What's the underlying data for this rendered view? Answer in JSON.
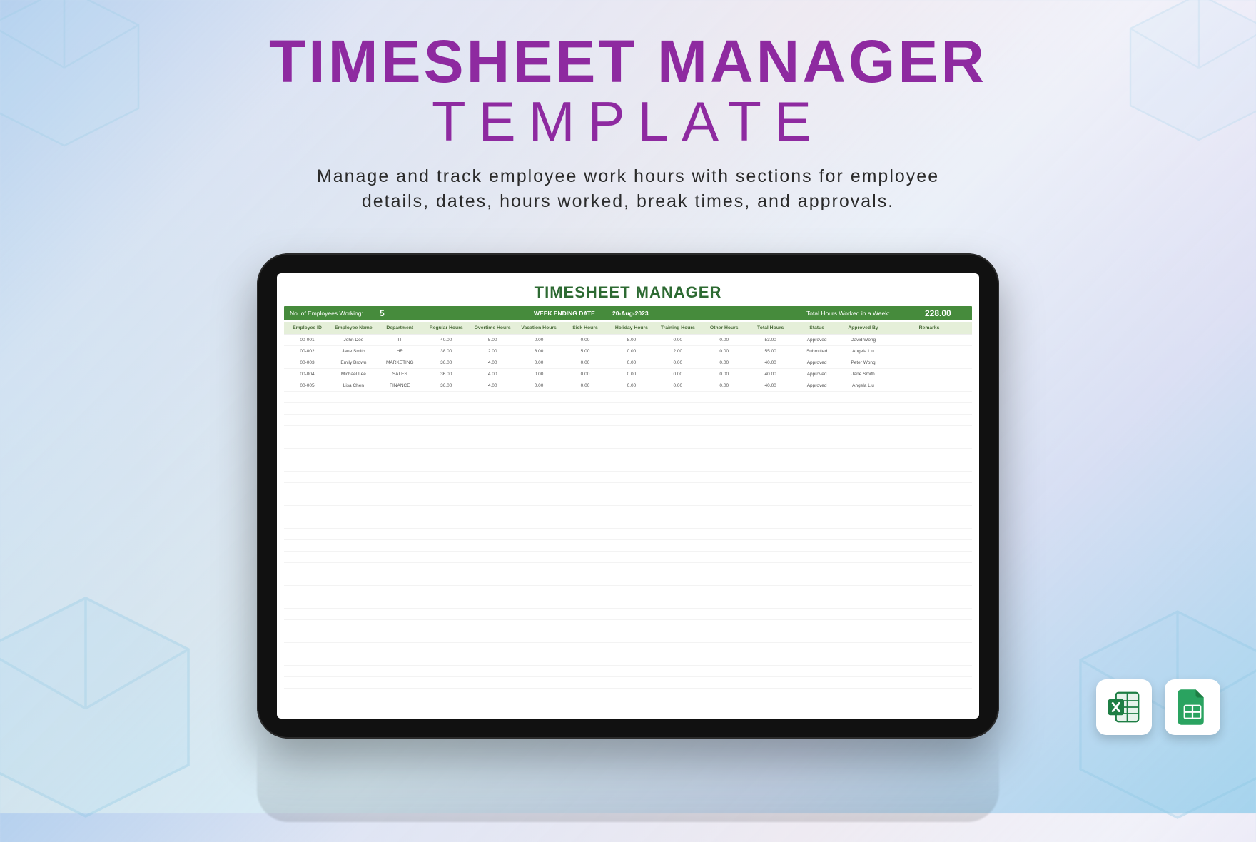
{
  "header": {
    "title_line1": "TIMESHEET MANAGER",
    "title_line2": "TEMPLATE",
    "subtitle_line1": "Manage and track employee work hours with sections for employee",
    "subtitle_line2": "details, dates, hours worked, break times, and approvals."
  },
  "sheet": {
    "title": "TIMESHEET MANAGER",
    "summary": {
      "employees_label": "No. of Employees Working:",
      "employees_value": "5",
      "week_ending_label": "WEEK ENDING DATE",
      "week_ending_value": "20-Aug-2023",
      "total_hours_label": "Total Hours Worked in a Week:",
      "total_hours_value": "228.00"
    },
    "columns": [
      "Employee ID",
      "Employee Name",
      "Department",
      "Regular Hours",
      "Overtime Hours",
      "Vacation Hours",
      "Sick Hours",
      "Holiday Hours",
      "Training Hours",
      "Other Hours",
      "Total Hours",
      "Status",
      "Approved By",
      "Remarks"
    ],
    "rows": [
      {
        "id": "00-001",
        "name": "John Doe",
        "dept": "IT",
        "reg": "40.00",
        "ot": "5.00",
        "vac": "0.00",
        "sick": "0.00",
        "hol": "8.00",
        "trn": "0.00",
        "oth": "0.00",
        "tot": "53.00",
        "status": "Approved",
        "appr": "David Wong",
        "rem": ""
      },
      {
        "id": "00-002",
        "name": "Jane Smith",
        "dept": "HR",
        "reg": "38.00",
        "ot": "2.00",
        "vac": "8.00",
        "sick": "5.00",
        "hol": "0.00",
        "trn": "2.00",
        "oth": "0.00",
        "tot": "55.00",
        "status": "Submitted",
        "appr": "Angela Liu",
        "rem": ""
      },
      {
        "id": "00-003",
        "name": "Emily Brown",
        "dept": "MARKETING",
        "reg": "36.00",
        "ot": "4.00",
        "vac": "0.00",
        "sick": "0.00",
        "hol": "0.00",
        "trn": "0.00",
        "oth": "0.00",
        "tot": "40.00",
        "status": "Approved",
        "appr": "Peter Wong",
        "rem": ""
      },
      {
        "id": "00-004",
        "name": "Michael Lee",
        "dept": "SALES",
        "reg": "36.00",
        "ot": "4.00",
        "vac": "0.00",
        "sick": "0.00",
        "hol": "0.00",
        "trn": "0.00",
        "oth": "0.00",
        "tot": "40.00",
        "status": "Approved",
        "appr": "Jane Smith",
        "rem": ""
      },
      {
        "id": "00-005",
        "name": "Lisa Chen",
        "dept": "FINANCE",
        "reg": "36.00",
        "ot": "4.00",
        "vac": "0.00",
        "sick": "0.00",
        "hol": "0.00",
        "trn": "0.00",
        "oth": "0.00",
        "tot": "40.00",
        "status": "Approved",
        "appr": "Angela Liu",
        "rem": ""
      }
    ],
    "empty_rows": 26
  },
  "file_icons": {
    "excel": "Excel",
    "sheets": "Google Sheets"
  }
}
